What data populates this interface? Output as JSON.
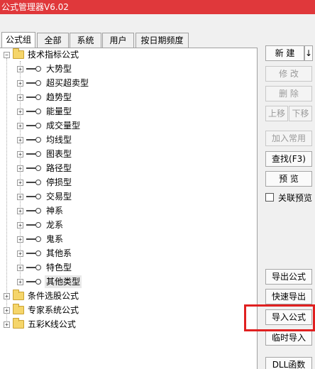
{
  "window": {
    "title": "公式管理器V6.02",
    "title_bar_color": "#e0383b"
  },
  "tabs": [
    "公式组",
    "全部",
    "系统",
    "用户",
    "按日期频度"
  ],
  "tree": {
    "root": "技术指标公式",
    "children": [
      "大势型",
      "超买超卖型",
      "趋势型",
      "能量型",
      "成交量型",
      "均线型",
      "图表型",
      "路径型",
      "停损型",
      "交易型",
      "神系",
      "龙系",
      "鬼系",
      "其他系",
      "特色型",
      "其他类型"
    ],
    "selected_child": "其他类型",
    "others": [
      "条件选股公式",
      "专家系统公式",
      "五彩K线公式"
    ]
  },
  "buttons": {
    "new": "新  建",
    "new_arrow": "↓",
    "edit": "修  改",
    "delete": "删  除",
    "move_up": "上移",
    "move_down": "下移",
    "add_common": "加入常用",
    "find": "查找(F3)",
    "preview": "预  览",
    "assoc_preview": "关联预览",
    "export": "导出公式",
    "quick_export": "快速导出",
    "import": "导入公式",
    "temp_import": "临时导入",
    "dll": "DLL函数"
  },
  "highlight_color": "#e02020"
}
